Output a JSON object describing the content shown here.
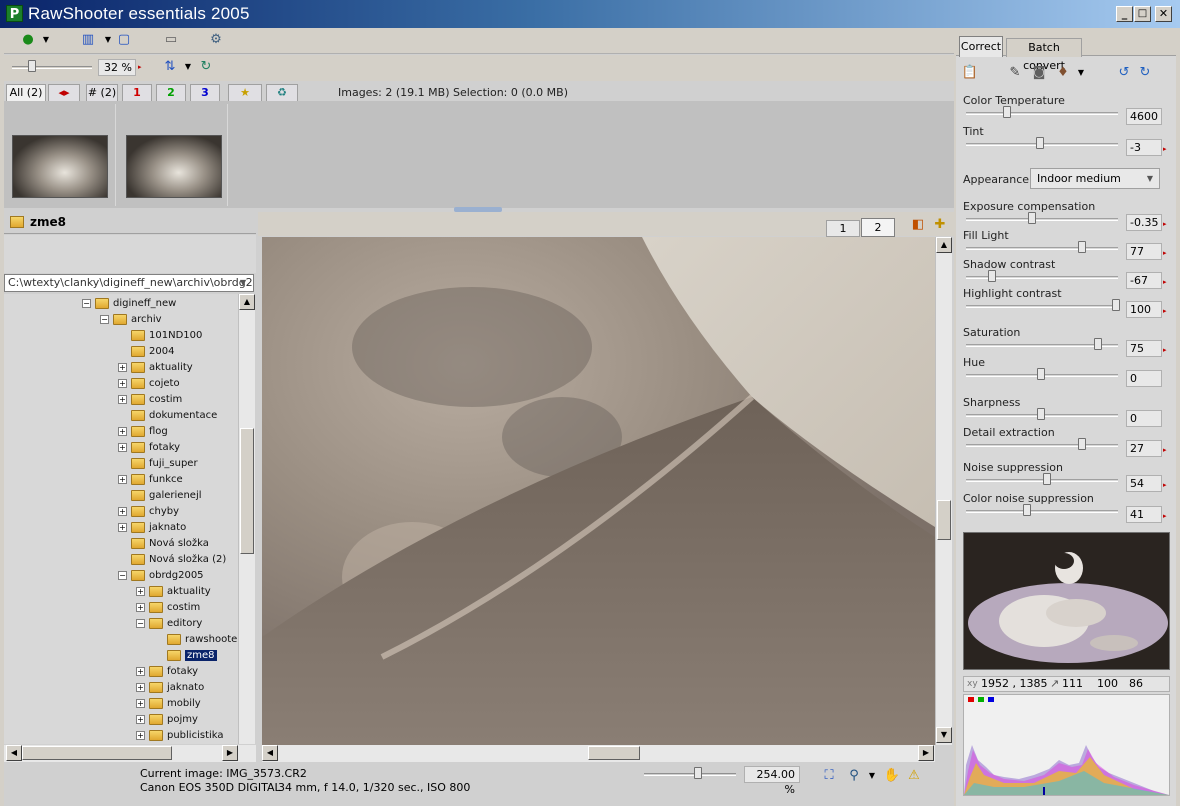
{
  "app": {
    "title": "RawShooter essentials 2005",
    "logo_letter": "P"
  },
  "window_controls": {
    "minimize": "_",
    "maximize": "□",
    "close": "✕"
  },
  "toolbar": {
    "zoom_value": "32 %"
  },
  "filter_tabs": [
    {
      "label": "All (2)",
      "color": "#000000"
    },
    {
      "label": "◂▸",
      "color": "#c00000"
    },
    {
      "label": "# (2)",
      "color": "#000000"
    },
    {
      "label": "1",
      "color": "#d00000"
    },
    {
      "label": "2",
      "color": "#00a000"
    },
    {
      "label": "3",
      "color": "#0000d0"
    },
    {
      "label": "★",
      "color": "#c8a000"
    },
    {
      "label": "♻",
      "color": "#208080"
    }
  ],
  "images_info": "Images: 2 (19.1 MB) Selection: 0 (0.0 MB)",
  "folder_panel": {
    "title": "zme8",
    "path": "C:\\wtexty\\clanky\\digineff_new\\archiv\\obrdg200"
  },
  "tree": [
    {
      "label": "digineff_new",
      "level": 0,
      "expander": "−"
    },
    {
      "label": "archiv",
      "level": 1,
      "expander": "−"
    },
    {
      "label": "101ND100",
      "level": 2,
      "expander": ""
    },
    {
      "label": "2004",
      "level": 2,
      "expander": ""
    },
    {
      "label": "aktuality",
      "level": 2,
      "expander": "+"
    },
    {
      "label": "cojeto",
      "level": 2,
      "expander": "+"
    },
    {
      "label": "costim",
      "level": 2,
      "expander": "+"
    },
    {
      "label": "dokumentace",
      "level": 2,
      "expander": ""
    },
    {
      "label": "flog",
      "level": 2,
      "expander": "+"
    },
    {
      "label": "fotaky",
      "level": 2,
      "expander": "+"
    },
    {
      "label": "fuji_super",
      "level": 2,
      "expander": ""
    },
    {
      "label": "funkce",
      "level": 2,
      "expander": "+"
    },
    {
      "label": "galerienejl",
      "level": 2,
      "expander": ""
    },
    {
      "label": "chyby",
      "level": 2,
      "expander": "+"
    },
    {
      "label": "jaknato",
      "level": 2,
      "expander": "+"
    },
    {
      "label": "Nová složka",
      "level": 2,
      "expander": ""
    },
    {
      "label": "Nová složka (2)",
      "level": 2,
      "expander": ""
    },
    {
      "label": "obrdg2005",
      "level": 2,
      "expander": "−"
    },
    {
      "label": "aktuality",
      "level": 3,
      "expander": "+"
    },
    {
      "label": "costim",
      "level": 3,
      "expander": "+"
    },
    {
      "label": "editory",
      "level": 3,
      "expander": "−"
    },
    {
      "label": "rawshoote",
      "level": 4,
      "expander": ""
    },
    {
      "label": "zme8",
      "level": 4,
      "expander": "",
      "selected": true
    },
    {
      "label": "fotaky",
      "level": 3,
      "expander": "+"
    },
    {
      "label": "jaknato",
      "level": 3,
      "expander": "+"
    },
    {
      "label": "mobily",
      "level": 3,
      "expander": "+"
    },
    {
      "label": "pojmy",
      "level": 3,
      "expander": "+"
    },
    {
      "label": "publicistika",
      "level": 3,
      "expander": "+"
    }
  ],
  "view_tabs": [
    "1",
    "2"
  ],
  "right_tabs": {
    "correct": "Correct",
    "batch": "Batch convert"
  },
  "sliders": [
    {
      "label": "Color Temperature",
      "value": "4600",
      "pos": 0.27,
      "arrow": false
    },
    {
      "label": "Tint",
      "value": "-3",
      "pos": 0.49,
      "arrow": true
    },
    {
      "label": "Exposure compensation",
      "value": "-0.35",
      "pos": 0.44,
      "arrow": true
    },
    {
      "label": "Fill Light",
      "value": "77",
      "pos": 0.77,
      "arrow": true
    },
    {
      "label": "Shadow contrast",
      "value": "-67",
      "pos": 0.17,
      "arrow": true
    },
    {
      "label": "Highlight contrast",
      "value": "100",
      "pos": 1.0,
      "arrow": true
    },
    {
      "label": "Saturation",
      "value": "75",
      "pos": 0.88,
      "arrow": true
    },
    {
      "label": "Hue",
      "value": "0",
      "pos": 0.5,
      "arrow": false
    },
    {
      "label": "Sharpness",
      "value": "0",
      "pos": 0.5,
      "arrow": false
    },
    {
      "label": "Detail extraction",
      "value": "27",
      "pos": 0.77,
      "arrow": true
    },
    {
      "label": "Noise suppression",
      "value": "54",
      "pos": 0.54,
      "arrow": true
    },
    {
      "label": "Color noise suppression",
      "value": "41",
      "pos": 0.41,
      "arrow": true
    }
  ],
  "appearance": {
    "label": "Appearance",
    "value": "Indoor medium"
  },
  "readout": {
    "coords": "1952 , 1385",
    "r": "111",
    "g": "100",
    "b": "86"
  },
  "status": {
    "current_image": "Current image: IMG_3573.CR2",
    "camera": "Canon EOS 350D DIGITAL",
    "exif": "34 mm, f 14.0, 1/320 sec., ISO 800",
    "zoom": "254.00 %"
  }
}
